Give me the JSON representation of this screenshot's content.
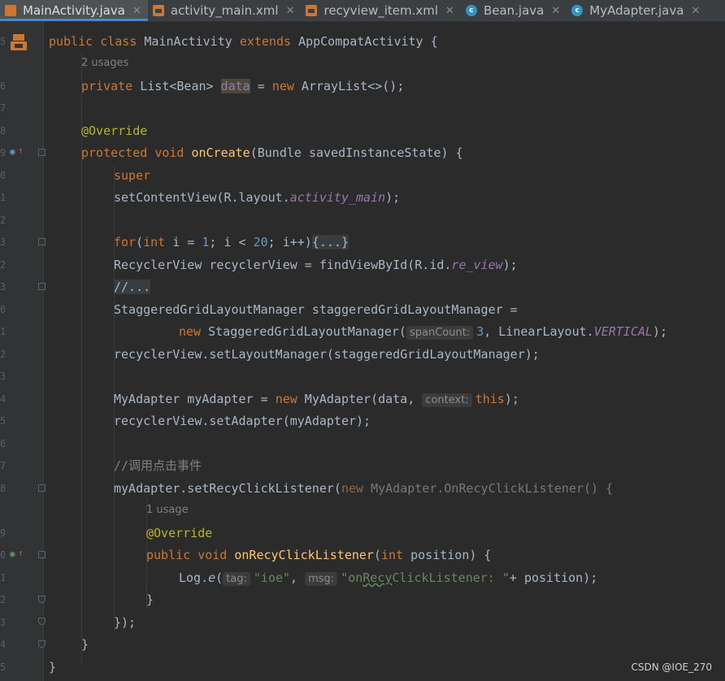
{
  "tabs": [
    {
      "label": "MainActivity.java",
      "icon": "java-file-icon",
      "active": true
    },
    {
      "label": "activity_main.xml",
      "icon": "xml-file-icon",
      "active": false
    },
    {
      "label": "recyview_item.xml",
      "icon": "xml-file-icon",
      "active": false
    },
    {
      "label": "Bean.java",
      "icon": "class-icon",
      "active": false
    },
    {
      "label": "MyAdapter.java",
      "icon": "class-icon",
      "active": false
    }
  ],
  "gutter": {
    "line_numbers": [
      "5",
      "6",
      "7",
      "8",
      "9",
      "0",
      "1",
      "2",
      "3",
      "2",
      "3",
      "0",
      "1",
      "2",
      "3",
      "4",
      "5",
      "6",
      "7",
      "8",
      "9",
      "0",
      "1",
      "2",
      "3",
      "4",
      "5",
      "6"
    ]
  },
  "code": {
    "class_decl": {
      "k1": "public",
      "k2": "class",
      "name": "MainActivity",
      "k3": "extends",
      "parent": "AppCompatActivity {"
    },
    "usages_2": "2 usages",
    "field_decl": {
      "k1": "private",
      "type": "List<Bean>",
      "name": "data",
      "eq": " = ",
      "k2": "new",
      "rest": " ArrayList<>();"
    },
    "override1": "@Override",
    "oncreate": {
      "k1": "protected",
      "k2": "void",
      "fn": "onCreate",
      "rest": "(Bundle savedInstanceState) {"
    },
    "super_call": {
      "k": "super",
      ".rest": ".onCreate(savedInstanceState);"
    },
    "set_content": {
      "pre": "setContentView(R.layout.",
      "field": "activity_main",
      "post": ");"
    },
    "for_line": {
      "k1": "for",
      "p1": "(",
      "k2": "int",
      "p2": " i = ",
      "n1": "1",
      "p3": "; i < ",
      "n2": "20",
      "p4": "; i++)",
      "folded": "{...}"
    },
    "recycler_line": {
      "pre": "RecyclerView recyclerView = findViewById(R.id.",
      "field": "re_view",
      "post": ");"
    },
    "folded_comment": "//...",
    "sgl_line1": "StaggeredGridLayoutManager staggeredGridLayoutManager =",
    "sgl_line2": {
      "k": "new",
      "pre": " StaggeredGridLayoutManager(",
      "hint": "spanCount:",
      "num": "3",
      "mid": ", LinearLayout.",
      "field": "VERTICAL",
      "post": ");"
    },
    "set_layout": "recyclerView.setLayoutManager(staggeredGridLayoutManager);",
    "adapter_line": {
      "pre": "MyAdapter myAdapter = ",
      "k": "new",
      "mid": " MyAdapter(data, ",
      "hint": "context:",
      "k2": "this",
      "post": ");"
    },
    "set_adapter": "recyclerView.setAdapter(myAdapter);",
    "comment_cn": "//调用点击事件",
    "listener_line": {
      "pre": "myAdapter.setRecyClickListener(",
      "k": "new",
      "dim": " MyAdapter.OnRecyClickListener() {",
      "post": ""
    },
    "usage_1": "1 usage",
    "override2": "@Override",
    "on_recy": {
      "k1": "public",
      "k2": "void",
      "fn": "onRecyClickListener",
      "p1": "(",
      "k3": "int",
      "p2": " position) {"
    },
    "log_line": {
      "pre": "Log.",
      "fn": "e",
      "p1": "(",
      "hint1": "tag:",
      "s1": "\"ioe\"",
      "p2": ", ",
      "hint2": "msg:",
      "s2a": "\"on",
      "s2u": "Recy",
      "s2b": "ClickListener: \"",
      "post": "+ position);"
    },
    "close_brace_1": "}",
    "close_brace_2": "});",
    "close_brace_3": "}",
    "close_brace_4": "}"
  },
  "watermark": "CSDN @IOE_270"
}
